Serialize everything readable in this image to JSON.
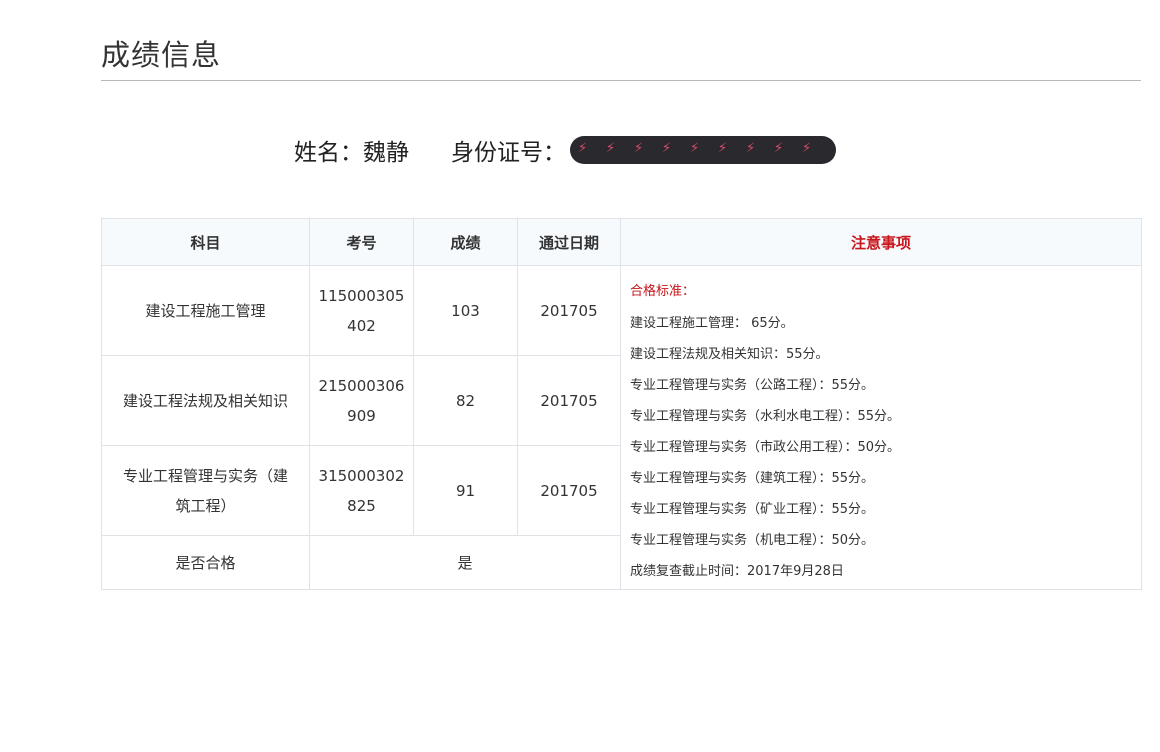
{
  "page": {
    "title": "成绩信息"
  },
  "identity": {
    "name_label": "姓名：",
    "name_value": "魏静",
    "id_label": "身份证号："
  },
  "table": {
    "headers": {
      "subject": "科目",
      "exam_no": "考号",
      "score": "成绩",
      "pass_date": "通过日期",
      "notice": "注意事项"
    },
    "rows": [
      {
        "subject": "建设工程施工管理",
        "exam_no_line1": "115000305",
        "exam_no_line2": "402",
        "score": "103",
        "pass_date": "201705"
      },
      {
        "subject": "建设工程法规及相关知识",
        "exam_no_line1": "215000306",
        "exam_no_line2": "909",
        "score": "82",
        "pass_date": "201705"
      },
      {
        "subject_line1": "专业工程管理与实务（建",
        "subject_line2": "筑工程）",
        "exam_no_line1": "315000302",
        "exam_no_line2": "825",
        "score": "91",
        "pass_date": "201705"
      }
    ],
    "pass_row": {
      "label": "是否合格",
      "value": "是"
    }
  },
  "notes": {
    "title": "合格标准：",
    "lines": [
      "建设工程施工管理： 65分。",
      "建设工程法规及相关知识：55分。",
      "专业工程管理与实务（公路工程）：55分。",
      "专业工程管理与实务（水利水电工程）：55分。",
      "专业工程管理与实务（市政公用工程）：50分。",
      "专业工程管理与实务（建筑工程）：55分。",
      "专业工程管理与实务（矿业工程）：55分。",
      "专业工程管理与实务（机电工程）：50分。",
      "成绩复查截止时间：2017年9月28日"
    ]
  },
  "colors": {
    "notice_red": "#c8161d",
    "header_bg": "#f7fafd",
    "border": "#dfe3e8"
  }
}
